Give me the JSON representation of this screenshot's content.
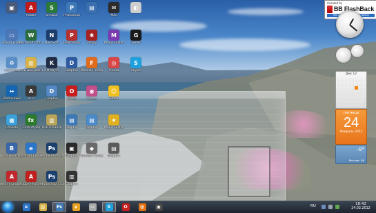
{
  "desktop_icons": [
    {
      "label": "",
      "color": "#4a5a7a",
      "glyph": "▣"
    },
    {
      "label": "Adobe",
      "color": "#c21a1a",
      "glyph": "A"
    },
    {
      "label": "Sindbot",
      "color": "#2a7a3a",
      "glyph": "S"
    },
    {
      "label": "Photoshop",
      "color": "#3d79b7",
      "glyph": "P"
    },
    {
      "label": "",
      "color": "#3a6fb0",
      "glyph": "▤"
    },
    {
      "label": "Mail",
      "color": "#2c2c2c",
      "glyph": "✉"
    },
    {
      "label": "",
      "color": "#cfcfcf",
      "glyph": "◐"
    },
    {
      "label": "Компьютер",
      "color": "#4d77b6",
      "glyph": "▭"
    },
    {
      "label": "Microsoft Office",
      "color": "#2a6c3d",
      "glyph": "W"
    },
    {
      "label": "NeroSoft",
      "color": "#1d3d6b",
      "glyph": "N"
    },
    {
      "label": "Photoshop",
      "color": "#b53030",
      "glyph": "P"
    },
    {
      "label": "Vitaliy",
      "color": "#a42222",
      "glyph": "✱"
    },
    {
      "label": "Magic Bullet",
      "color": "#7a3bb0",
      "glyph": "M"
    },
    {
      "label": "Tweak",
      "color": "#1a1a1a",
      "glyph": "G"
    },
    {
      "label": "Корзина",
      "color": "#5a8ec9",
      "glyph": "♻"
    },
    {
      "label": "Мои документы",
      "color": "#d6b248",
      "glyph": "▥"
    },
    {
      "label": "КМPlayer",
      "color": "#1f2c43",
      "glyph": "K"
    },
    {
      "label": "Dolphin",
      "color": "#2d5aa0",
      "glyph": "D"
    },
    {
      "label": "Mozilla Firefox",
      "color": "#e06b1c",
      "glyph": "F"
    },
    {
      "label": "Picasa",
      "color": "#d94646",
      "glyph": "◎"
    },
    {
      "label": "Skype",
      "color": "#1ea0dc",
      "glyph": "S"
    },
    {
      "label": "TeamViewer",
      "color": "#1466b4",
      "glyph": "↔"
    },
    {
      "label": "Avid",
      "color": "#3a3a3a",
      "glyph": "A"
    },
    {
      "label": "Dolphin",
      "color": "#5487c4",
      "glyph": "D"
    },
    {
      "label": "Opera",
      "color": "#c81e1e",
      "glyph": "O"
    },
    {
      "label": "Picasa",
      "color": "#c04f8a",
      "glyph": "◉"
    },
    {
      "label": "Smile",
      "color": "#f0c020",
      "glyph": "☺"
    },
    {
      "label": "Сonsole",
      "color": "#3aa0d9",
      "glyph": "▦"
    },
    {
      "label": "1115 styles",
      "color": "#2b7a2b",
      "glyph": "fx"
    },
    {
      "label": "PHOTOSHOP",
      "color": "#b8a458",
      "glyph": "▥"
    },
    {
      "label": "Dolphin",
      "color": "#3d79b7",
      "glyph": "▤"
    },
    {
      "label": "Dolphin",
      "color": "#4a8ac9",
      "glyph": "▤"
    },
    {
      "label": "Magic Bullet",
      "color": "#e0b020",
      "glyph": "★"
    },
    {
      "label": "Вкла Вконтакте",
      "color": "#3a67a8",
      "glyph": "B"
    },
    {
      "label": "Internet Explorer",
      "color": "#2b76c9",
      "glyph": "e"
    },
    {
      "label": "Adobe Photoshop",
      "color": "#1b3f6e",
      "glyph": "Ps"
    },
    {
      "label": "Dolphin",
      "color": "#2a2a2a",
      "glyph": "▣"
    },
    {
      "label": "Counter Strike",
      "color": "#6a6a6a",
      "glyph": "◆"
    },
    {
      "label": "Dolphin",
      "color": "#5a5a5a",
      "glyph": "▤"
    },
    {
      "label": "ABBYY Lingvo x3",
      "color": "#c0282d",
      "glyph": "A"
    },
    {
      "label": "Adobe Photoshop",
      "color": "#c12020",
      "glyph": "A"
    },
    {
      "label": "Photoshop CS3",
      "color": "#1b3f6e",
      "glyph": "Ps"
    },
    {
      "label": "Dolphin",
      "color": "#333333",
      "glyph": "▥"
    }
  ],
  "bbflashback": {
    "created_by": "Created by",
    "brand": "BB FlashBack",
    "trial": "This image removed after licence"
  },
  "calendar": {
    "month": "Дек 12"
  },
  "date_gadget": {
    "day_of_week": "пятница",
    "day": "24",
    "month_year": "Февраль 2012"
  },
  "weather": {
    "temp": "-8°",
    "city": "Москва, UK"
  },
  "taskbar": {
    "language": "RU",
    "time": "18:42",
    "date": "24.02.2012",
    "buttons": [
      {
        "name": "ie",
        "glyph": "e",
        "color": "#2b76c9",
        "active": false
      },
      {
        "name": "explorer",
        "glyph": "▥",
        "color": "#d6b248",
        "active": false
      },
      {
        "name": "photoshop",
        "glyph": "Ps",
        "color": "#3d79b7",
        "active": true
      },
      {
        "name": "winamp",
        "glyph": "◈",
        "color": "#e8a020",
        "active": false
      },
      {
        "name": "window",
        "glyph": "▭",
        "color": "#aaaaaa",
        "active": false
      },
      {
        "name": "skype",
        "glyph": "S",
        "color": "#1ea0dc",
        "active": true
      },
      {
        "name": "opera",
        "glyph": "O",
        "color": "#c81e1e",
        "active": false
      },
      {
        "name": "agent",
        "glyph": "@",
        "color": "#e07010",
        "active": false
      },
      {
        "name": "avid",
        "glyph": "▣",
        "color": "#444444",
        "active": false
      }
    ]
  },
  "colors": {
    "accent": "#2d8be0",
    "date_orange": "#f28a1a"
  }
}
